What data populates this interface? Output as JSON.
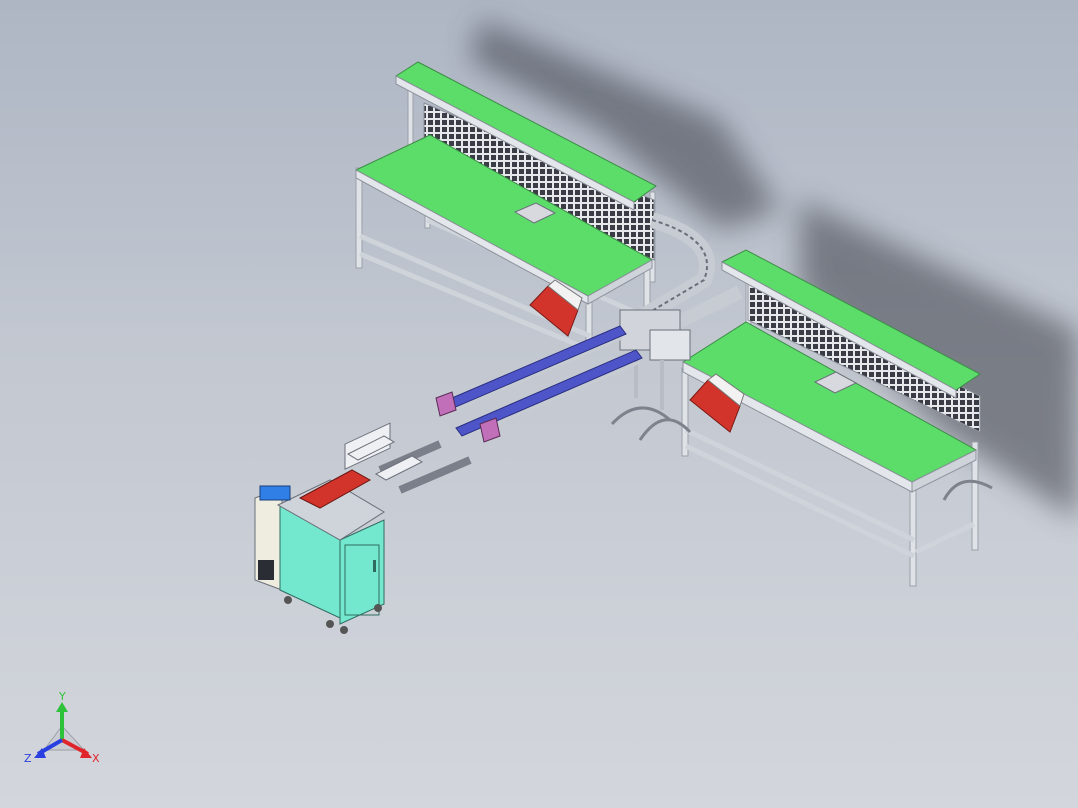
{
  "model": {
    "colors": {
      "background_top": "#aeb6c4",
      "background_bottom": "#d3d6dc",
      "tabletop": "#5cdd6a",
      "frame": "#d4d8df",
      "cabinet": "#74e8cf",
      "conveyor_belt": "#4d55c8",
      "hopper": "#d2342b",
      "shadow": "#3c4048"
    },
    "components": [
      "workbench-left",
      "workbench-right",
      "curved-conveyor",
      "straight-conveyor",
      "control-cabinet"
    ]
  },
  "triad": {
    "y_label": "Y",
    "z_label": "Z",
    "x_label": "X",
    "y_color": "#2ec23a",
    "z_color": "#2a3fe0",
    "x_color": "#e0262a"
  }
}
